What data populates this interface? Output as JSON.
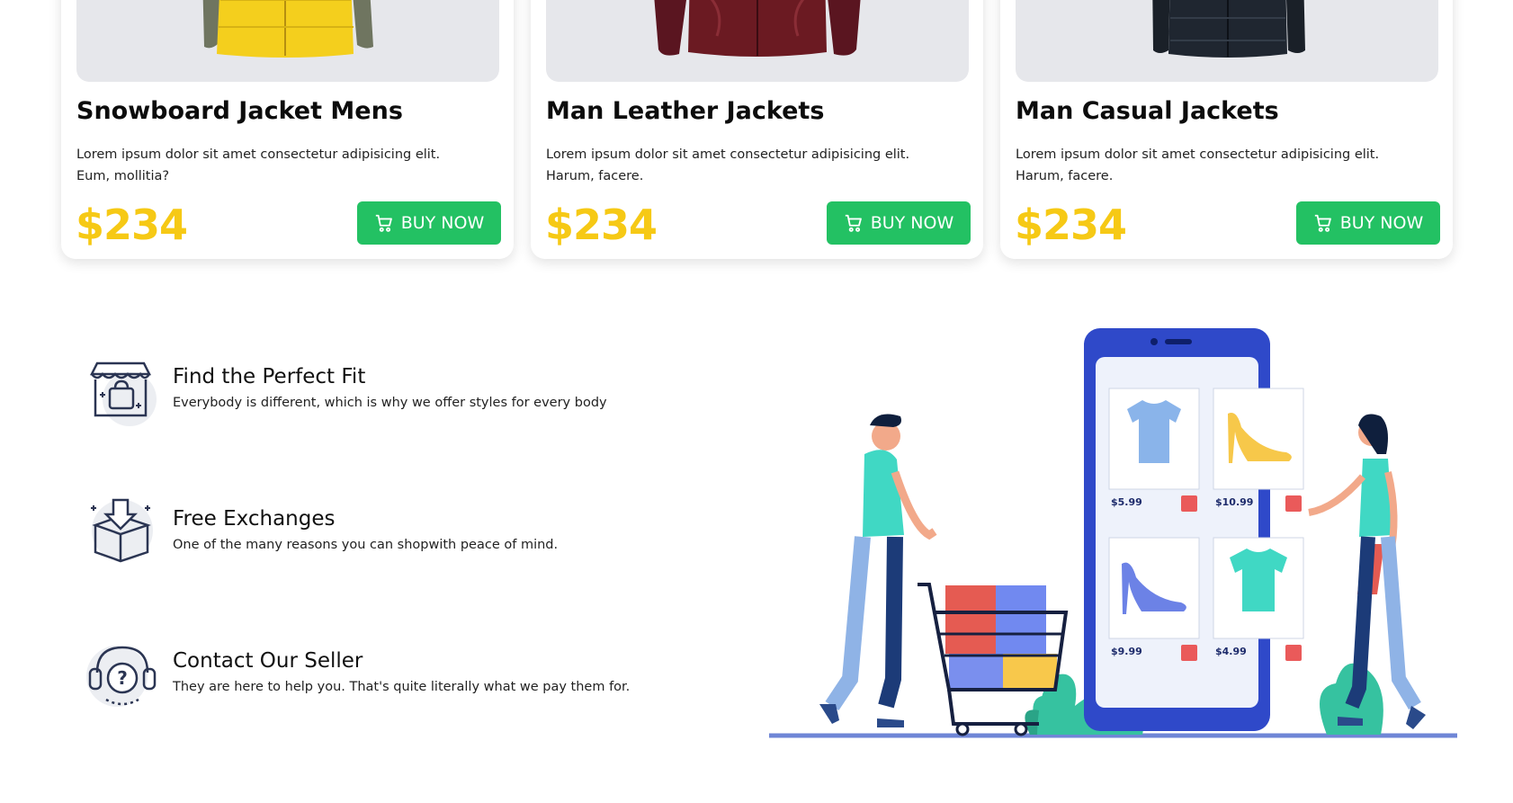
{
  "products": [
    {
      "name": "Snowboard Jacket Mens",
      "description": "Lorem ipsum dolor sit amet consectetur adipisicing elit. Eum, mollitia?",
      "price": "$234",
      "button": "BUY NOW",
      "jacket_color": "#f4cf1d"
    },
    {
      "name": "Man Leather Jackets",
      "description": "Lorem ipsum dolor sit amet consectetur adipisicing elit. Harum, facere.",
      "price": "$234",
      "button": "BUY NOW",
      "jacket_color": "#6b1a22"
    },
    {
      "name": "Man Casual Jackets",
      "description": "Lorem ipsum dolor sit amet consectetur adipisicing elit. Harum, facere.",
      "price": "$234",
      "button": "BUY NOW",
      "jacket_color": "#1f2630"
    }
  ],
  "features": [
    {
      "title": "Find the Perfect Fit",
      "description": "Everybody is different, which is why we offer styles for every body",
      "icon": "shop-bag-icon"
    },
    {
      "title": "Free Exchanges",
      "description": "One of the many reasons you can shopwith peace of mind.",
      "icon": "box-exchange-icon"
    },
    {
      "title": "Contact Our Seller",
      "description": "They are here to help you. That's quite literally what we pay them for.",
      "icon": "support-headset-icon"
    }
  ],
  "illustration": {
    "prices": [
      "$5.99",
      "$10.99",
      "$9.99",
      "$4.99"
    ]
  },
  "colors": {
    "price": "#f6c915",
    "buy_button": "#23c163",
    "phone": "#2f49c9"
  }
}
